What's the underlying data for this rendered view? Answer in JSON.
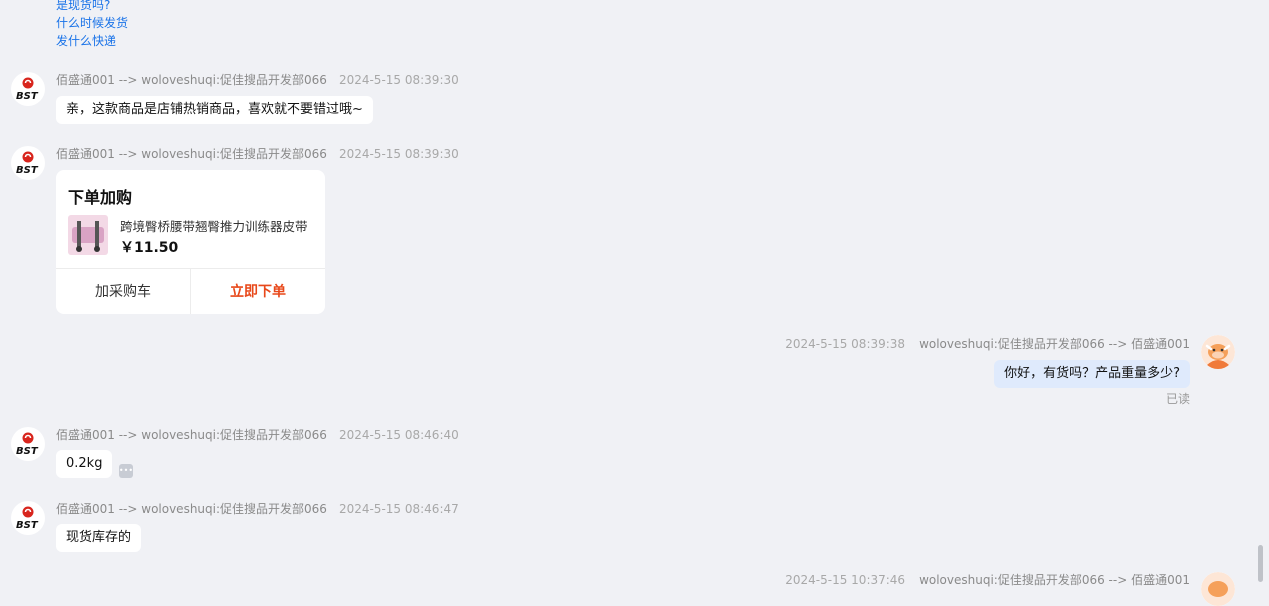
{
  "quick_questions": [
    "是现货吗?",
    "什么时候发货",
    "发什么快递"
  ],
  "shop_sender": "佰盛通001 --> woloveshuqi:促佳搜品开发部066",
  "user_sender": "woloveshuqi:促佳搜品开发部066 --> 佰盛通001",
  "shop_avatar_text": "BST",
  "messages": [
    {
      "time": "2024-5-15 08:39:30",
      "text": "亲，这款商品是店铺热销商品，喜欢就不要错过哦~"
    },
    {
      "time": "2024-5-15 08:39:30"
    },
    {
      "time": "2024-5-15 08:39:38",
      "text": "你好，有货吗？产品重量多少?",
      "status": "已读"
    },
    {
      "time": "2024-5-15 08:46:40",
      "text": "0.2kg"
    },
    {
      "time": "2024-5-15 08:46:47",
      "text": "现货库存的"
    },
    {
      "time": "2024-5-15 10:37:46"
    }
  ],
  "order_card": {
    "title": "下单加购",
    "product_name": "跨境臀桥腰带翘臀推力训练器皮带",
    "price": "￥11.50",
    "add_cart": "加采购车",
    "buy_now": "立即下单"
  },
  "colors": {
    "link": "#1a73e8",
    "buy": "#e8481a",
    "mine_bubble": "#dfeafc",
    "background": "#f0f1f5"
  }
}
